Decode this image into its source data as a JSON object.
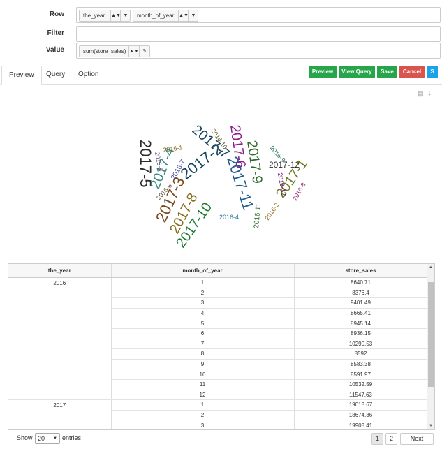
{
  "form": {
    "row_label": "Row",
    "filter_label": "Filter",
    "value_label": "Value",
    "row_fields": [
      "the_year",
      "month_of_year"
    ],
    "value_field": "sum(store_sales)"
  },
  "tabs": [
    "Preview",
    "Query",
    "Option"
  ],
  "actions": {
    "preview": "Preview",
    "view_query": "View Query",
    "save": "Save",
    "cancel": "Cancel",
    "s": "S"
  },
  "colors": {
    "preview": "#27a54a",
    "view_query": "#27a54a",
    "save": "#27a54a",
    "cancel": "#d9534f",
    "s": "#1aa3e8"
  },
  "icons": [
    "file-icon",
    "download-icon"
  ],
  "wordcloud": [
    {
      "text": "2017-5",
      "color": "#2b2b2b"
    },
    {
      "text": "2017-4",
      "color": "#3a8a85"
    },
    {
      "text": "2017-3",
      "color": "#7a4a1e"
    },
    {
      "text": "2017-8",
      "color": "#8a6d1f"
    },
    {
      "text": "2017-7",
      "color": "#17445f"
    },
    {
      "text": "2017-2",
      "color": "#17445f"
    },
    {
      "text": "2017-10",
      "color": "#1e7a35"
    },
    {
      "text": "2017-6",
      "color": "#8a1e8a"
    },
    {
      "text": "2017-11",
      "color": "#1f5c8c"
    },
    {
      "text": "2017-9",
      "color": "#2d6b2a"
    },
    {
      "text": "2017-12",
      "color": "#2b2b2b"
    },
    {
      "text": "2017-1",
      "color": "#6b7a20"
    },
    {
      "text": "2016-1",
      "color": "#8a6d1f"
    },
    {
      "text": "2016-5",
      "color": "#6b4a7a"
    },
    {
      "text": "2016-7",
      "color": "#4a4aa0"
    },
    {
      "text": "2016-6",
      "color": "#5a4a2e"
    },
    {
      "text": "2016-10",
      "color": "#5a5a1e"
    },
    {
      "text": "2016-9",
      "color": "#1e6b5a"
    },
    {
      "text": "2016-12",
      "color": "#2b1e1e"
    },
    {
      "text": "2016-3",
      "color": "#8a1e8a"
    },
    {
      "text": "2016-8",
      "color": "#8a1e6b"
    },
    {
      "text": "2016-11",
      "color": "#2d6b2a"
    },
    {
      "text": "2016-2",
      "color": "#8a6d1f"
    },
    {
      "text": "2016-4",
      "color": "#1f7aa0"
    }
  ],
  "table": {
    "headers": [
      "the_year",
      "month_of_year",
      "store_sales"
    ],
    "groups": [
      {
        "year": "2016",
        "rows": [
          [
            "1",
            "8640.71"
          ],
          [
            "2",
            "8376.4"
          ],
          [
            "3",
            "9401.49"
          ],
          [
            "4",
            "8665.41"
          ],
          [
            "5",
            "8945.14"
          ],
          [
            "6",
            "8936.15"
          ],
          [
            "7",
            "10290.53"
          ],
          [
            "8",
            "8592"
          ],
          [
            "9",
            "8583.38"
          ],
          [
            "10",
            "8591.97"
          ],
          [
            "11",
            "10532.59"
          ],
          [
            "12",
            "11547.63"
          ]
        ]
      },
      {
        "year": "2017",
        "rows": [
          [
            "1",
            "19018.67"
          ],
          [
            "2",
            "18674.36"
          ],
          [
            "3",
            "19908.41"
          ]
        ]
      }
    ]
  },
  "footer": {
    "show": "Show",
    "page_size": "20",
    "entries": "entries",
    "pages": [
      "1",
      "2"
    ],
    "next": "Next"
  }
}
